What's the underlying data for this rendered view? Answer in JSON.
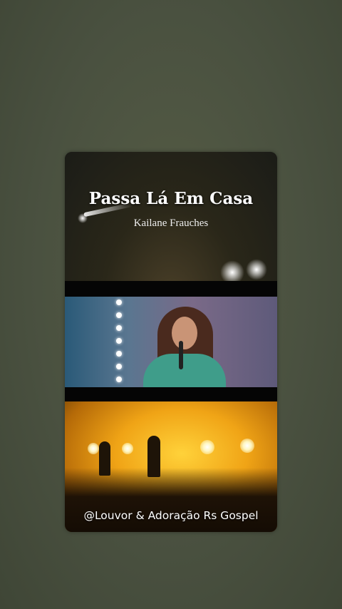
{
  "video": {
    "title": "Passa Lá Em Casa",
    "artist": "Kailane Frauches",
    "watermark": "@Louvor & Adoração Rs Gospel"
  }
}
